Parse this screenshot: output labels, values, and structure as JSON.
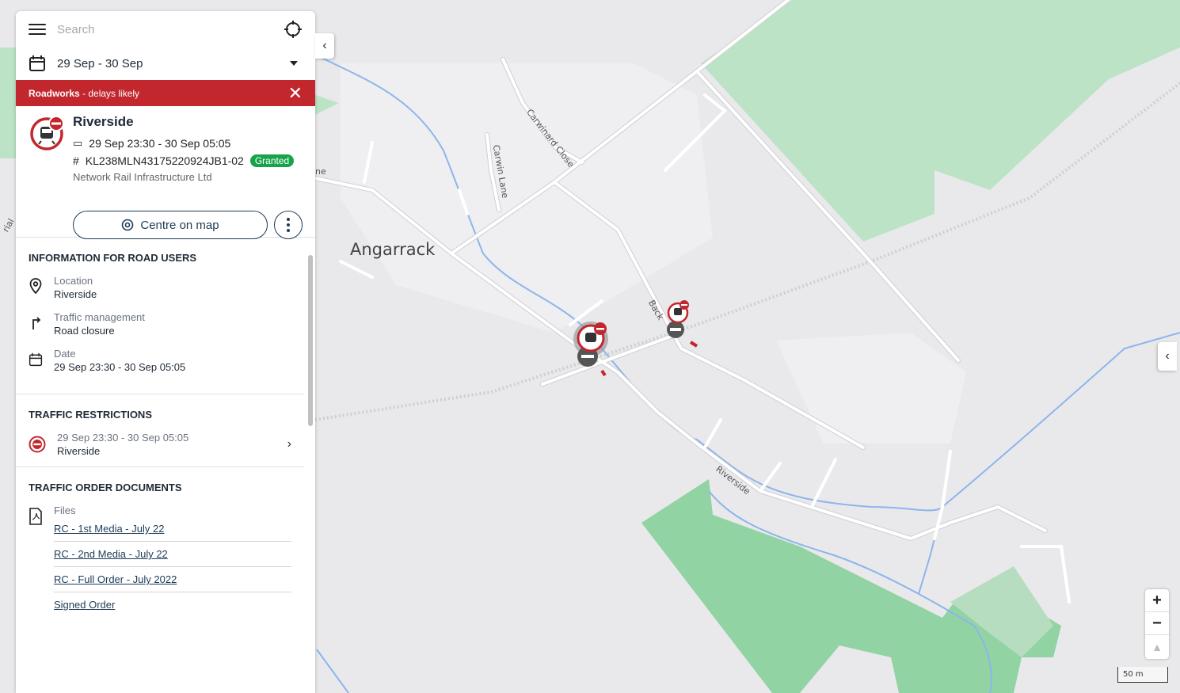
{
  "search": {
    "placeholder": "Search"
  },
  "date_filter": {
    "value": "29 Sep - 30 Sep"
  },
  "alert": {
    "strong": "Roadworks",
    "rest": " - delays likely"
  },
  "work": {
    "title": "Riverside",
    "dates": "29 Sep 23:30 - 30 Sep 05:05",
    "reference": "KL238MLN43175220924JB1-02",
    "status": "Granted",
    "organisation": "Network Rail Infrastructure Ltd",
    "centre_label": "Centre on map"
  },
  "road_users": {
    "heading": "INFORMATION FOR ROAD USERS",
    "location_label": "Location",
    "location_value": "Riverside",
    "traffic_label": "Traffic management",
    "traffic_value": "Road closure",
    "date_label": "Date",
    "date_value": "29 Sep 23:30 - 30 Sep 05:05"
  },
  "restrictions": {
    "heading": "TRAFFIC RESTRICTIONS",
    "dates": "29 Sep 23:30 - 30 Sep 05:05",
    "road": "Riverside"
  },
  "documents": {
    "heading": "TRAFFIC ORDER DOCUMENTS",
    "files_label": "Files",
    "files": [
      "RC - 1st Media - July 22",
      "RC - 2nd Media - July 22",
      "RC - Full Order - July 2022",
      "Signed Order"
    ]
  },
  "map": {
    "place": "Angarrack",
    "streets": [
      "Carwinard Close",
      "Carwin Lane",
      "Riverside",
      "Back",
      "ne",
      "rial"
    ],
    "scale": "50 m"
  },
  "colors": {
    "alert": "#c1272d",
    "granted": "#16a34a",
    "link": "#1d3b57",
    "green": "#91d3a3",
    "road": "#ffffff",
    "water": "#8cb5ec"
  }
}
